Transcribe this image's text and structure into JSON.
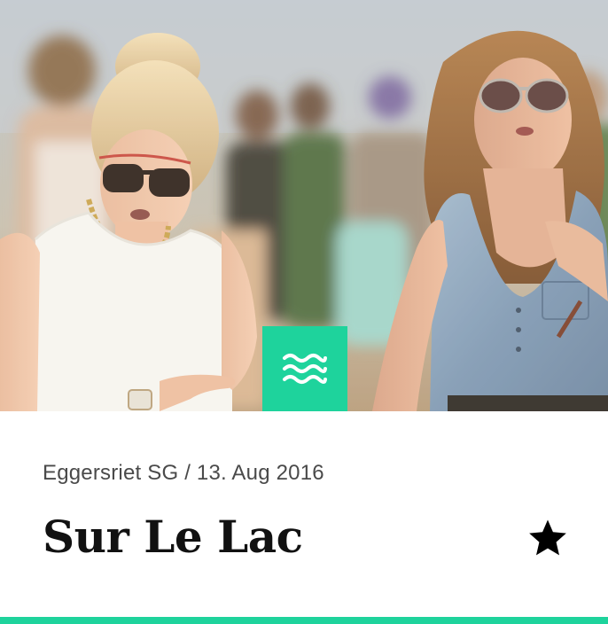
{
  "event": {
    "location_date": "Eggersriet SG / 13. Aug 2016",
    "title": "Sur Le Lac",
    "favorite_icon": "star-icon",
    "category_icon": "waves-icon"
  },
  "colors": {
    "accent": "#1ed39c",
    "title": "#111111",
    "meta": "#4a4a4a"
  }
}
